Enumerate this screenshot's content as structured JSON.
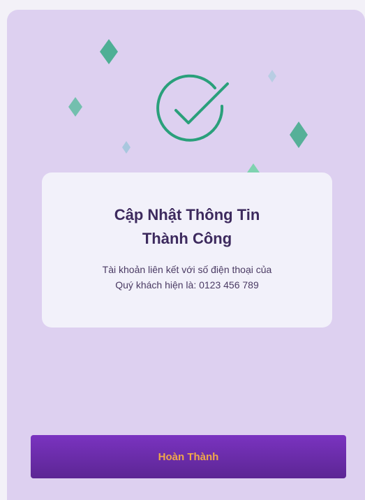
{
  "dialog": {
    "title_line1": "Cập Nhật Thông Tin",
    "title_line2": "Thành Công",
    "message_line1": "Tài khoản liên kết với số điện thoại của",
    "message_line2": "Quý khách hiện là: 0123 456 789"
  },
  "actions": {
    "done_label": "Hoàn Thành"
  },
  "icons": {
    "status": "check-circle-icon",
    "decoration": "sparkle-icon"
  },
  "colors": {
    "panel_background": "#ddd0f0",
    "card_background": "#f2f1fa",
    "accent_green": "#2aa07b",
    "button_purple": "#6b2bab",
    "button_text": "#f0a84a",
    "title_text": "#3d2a5e"
  }
}
